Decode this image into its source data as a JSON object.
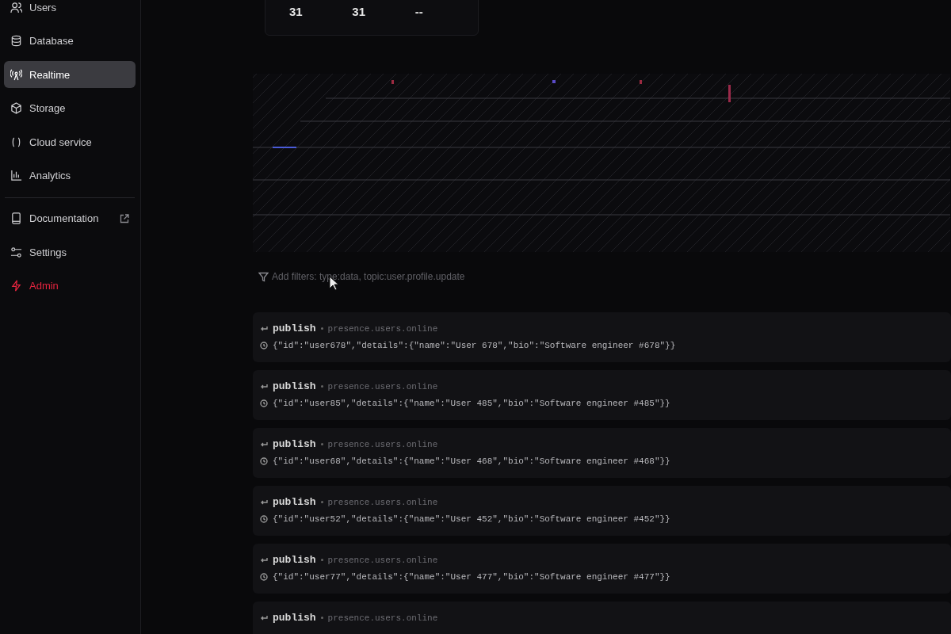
{
  "sidebar": {
    "groups": [
      {
        "items": [
          {
            "label": "Users",
            "kind": "nav",
            "selected": false
          },
          {
            "label": "Database",
            "kind": "nav",
            "selected": false
          },
          {
            "label": "Realtime",
            "kind": "nav",
            "selected": true
          },
          {
            "label": "Storage",
            "kind": "nav",
            "selected": false
          },
          {
            "label": "Cloud service",
            "kind": "nav",
            "selected": false
          },
          {
            "label": "Analytics",
            "kind": "nav",
            "selected": false
          }
        ]
      },
      {
        "items": [
          {
            "label": "Documentation",
            "kind": "external",
            "selected": false
          },
          {
            "label": "Settings",
            "kind": "nav",
            "selected": false
          },
          {
            "label": "Admin",
            "kind": "danger",
            "selected": false
          }
        ]
      }
    ]
  },
  "stats": [
    "31",
    "31",
    "--"
  ],
  "filter": {
    "placeholder": "Add filters: type:data, topic:user.profile.update"
  },
  "messages": [
    {
      "event": "publish",
      "topic": "presence.users.online",
      "payload": "{\"id\":\"user678\",\"details\":{\"name\":\"User 678\",\"bio\":\"Software engineer #678\"}}"
    },
    {
      "event": "publish",
      "topic": "presence.users.online",
      "payload": "{\"id\":\"user85\",\"details\":{\"name\":\"User 485\",\"bio\":\"Software engineer #485\"}}"
    },
    {
      "event": "publish",
      "topic": "presence.users.online",
      "payload": "{\"id\":\"user68\",\"details\":{\"name\":\"User 468\",\"bio\":\"Software engineer #468\"}}"
    },
    {
      "event": "publish",
      "topic": "presence.users.online",
      "payload": "{\"id\":\"user52\",\"details\":{\"name\":\"User 452\",\"bio\":\"Software engineer #452\"}}"
    },
    {
      "event": "publish",
      "topic": "presence.users.online",
      "payload": "{\"id\":\"user77\",\"details\":{\"name\":\"User 477\",\"bio\":\"Software engineer #477\"}}"
    },
    {
      "event": "publish",
      "topic": "presence.users.online"
    }
  ]
}
